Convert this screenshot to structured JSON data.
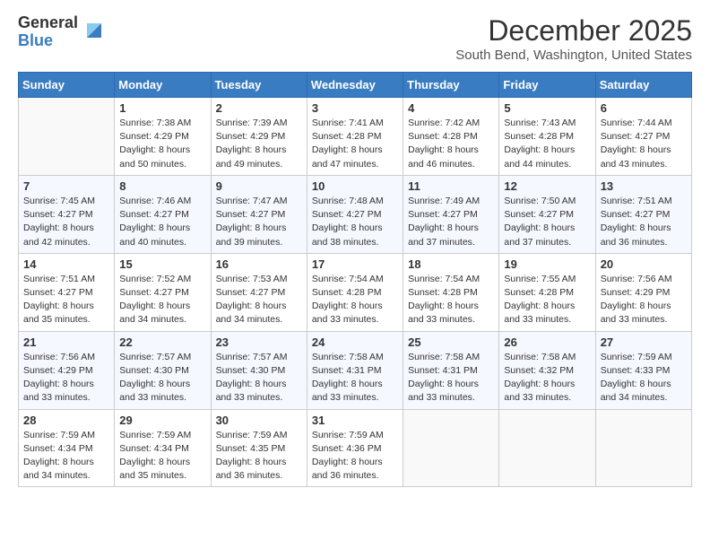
{
  "logo": {
    "general": "General",
    "blue": "Blue"
  },
  "title": "December 2025",
  "location": "South Bend, Washington, United States",
  "days_of_week": [
    "Sunday",
    "Monday",
    "Tuesday",
    "Wednesday",
    "Thursday",
    "Friday",
    "Saturday"
  ],
  "weeks": [
    [
      {
        "day": "",
        "info": ""
      },
      {
        "day": "1",
        "info": "Sunrise: 7:38 AM\nSunset: 4:29 PM\nDaylight: 8 hours\nand 50 minutes."
      },
      {
        "day": "2",
        "info": "Sunrise: 7:39 AM\nSunset: 4:29 PM\nDaylight: 8 hours\nand 49 minutes."
      },
      {
        "day": "3",
        "info": "Sunrise: 7:41 AM\nSunset: 4:28 PM\nDaylight: 8 hours\nand 47 minutes."
      },
      {
        "day": "4",
        "info": "Sunrise: 7:42 AM\nSunset: 4:28 PM\nDaylight: 8 hours\nand 46 minutes."
      },
      {
        "day": "5",
        "info": "Sunrise: 7:43 AM\nSunset: 4:28 PM\nDaylight: 8 hours\nand 44 minutes."
      },
      {
        "day": "6",
        "info": "Sunrise: 7:44 AM\nSunset: 4:27 PM\nDaylight: 8 hours\nand 43 minutes."
      }
    ],
    [
      {
        "day": "7",
        "info": "Sunrise: 7:45 AM\nSunset: 4:27 PM\nDaylight: 8 hours\nand 42 minutes."
      },
      {
        "day": "8",
        "info": "Sunrise: 7:46 AM\nSunset: 4:27 PM\nDaylight: 8 hours\nand 40 minutes."
      },
      {
        "day": "9",
        "info": "Sunrise: 7:47 AM\nSunset: 4:27 PM\nDaylight: 8 hours\nand 39 minutes."
      },
      {
        "day": "10",
        "info": "Sunrise: 7:48 AM\nSunset: 4:27 PM\nDaylight: 8 hours\nand 38 minutes."
      },
      {
        "day": "11",
        "info": "Sunrise: 7:49 AM\nSunset: 4:27 PM\nDaylight: 8 hours\nand 37 minutes."
      },
      {
        "day": "12",
        "info": "Sunrise: 7:50 AM\nSunset: 4:27 PM\nDaylight: 8 hours\nand 37 minutes."
      },
      {
        "day": "13",
        "info": "Sunrise: 7:51 AM\nSunset: 4:27 PM\nDaylight: 8 hours\nand 36 minutes."
      }
    ],
    [
      {
        "day": "14",
        "info": "Sunrise: 7:51 AM\nSunset: 4:27 PM\nDaylight: 8 hours\nand 35 minutes."
      },
      {
        "day": "15",
        "info": "Sunrise: 7:52 AM\nSunset: 4:27 PM\nDaylight: 8 hours\nand 34 minutes."
      },
      {
        "day": "16",
        "info": "Sunrise: 7:53 AM\nSunset: 4:27 PM\nDaylight: 8 hours\nand 34 minutes."
      },
      {
        "day": "17",
        "info": "Sunrise: 7:54 AM\nSunset: 4:28 PM\nDaylight: 8 hours\nand 33 minutes."
      },
      {
        "day": "18",
        "info": "Sunrise: 7:54 AM\nSunset: 4:28 PM\nDaylight: 8 hours\nand 33 minutes."
      },
      {
        "day": "19",
        "info": "Sunrise: 7:55 AM\nSunset: 4:28 PM\nDaylight: 8 hours\nand 33 minutes."
      },
      {
        "day": "20",
        "info": "Sunrise: 7:56 AM\nSunset: 4:29 PM\nDaylight: 8 hours\nand 33 minutes."
      }
    ],
    [
      {
        "day": "21",
        "info": "Sunrise: 7:56 AM\nSunset: 4:29 PM\nDaylight: 8 hours\nand 33 minutes."
      },
      {
        "day": "22",
        "info": "Sunrise: 7:57 AM\nSunset: 4:30 PM\nDaylight: 8 hours\nand 33 minutes."
      },
      {
        "day": "23",
        "info": "Sunrise: 7:57 AM\nSunset: 4:30 PM\nDaylight: 8 hours\nand 33 minutes."
      },
      {
        "day": "24",
        "info": "Sunrise: 7:58 AM\nSunset: 4:31 PM\nDaylight: 8 hours\nand 33 minutes."
      },
      {
        "day": "25",
        "info": "Sunrise: 7:58 AM\nSunset: 4:31 PM\nDaylight: 8 hours\nand 33 minutes."
      },
      {
        "day": "26",
        "info": "Sunrise: 7:58 AM\nSunset: 4:32 PM\nDaylight: 8 hours\nand 33 minutes."
      },
      {
        "day": "27",
        "info": "Sunrise: 7:59 AM\nSunset: 4:33 PM\nDaylight: 8 hours\nand 34 minutes."
      }
    ],
    [
      {
        "day": "28",
        "info": "Sunrise: 7:59 AM\nSunset: 4:34 PM\nDaylight: 8 hours\nand 34 minutes."
      },
      {
        "day": "29",
        "info": "Sunrise: 7:59 AM\nSunset: 4:34 PM\nDaylight: 8 hours\nand 35 minutes."
      },
      {
        "day": "30",
        "info": "Sunrise: 7:59 AM\nSunset: 4:35 PM\nDaylight: 8 hours\nand 36 minutes."
      },
      {
        "day": "31",
        "info": "Sunrise: 7:59 AM\nSunset: 4:36 PM\nDaylight: 8 hours\nand 36 minutes."
      },
      {
        "day": "",
        "info": ""
      },
      {
        "day": "",
        "info": ""
      },
      {
        "day": "",
        "info": ""
      }
    ]
  ]
}
